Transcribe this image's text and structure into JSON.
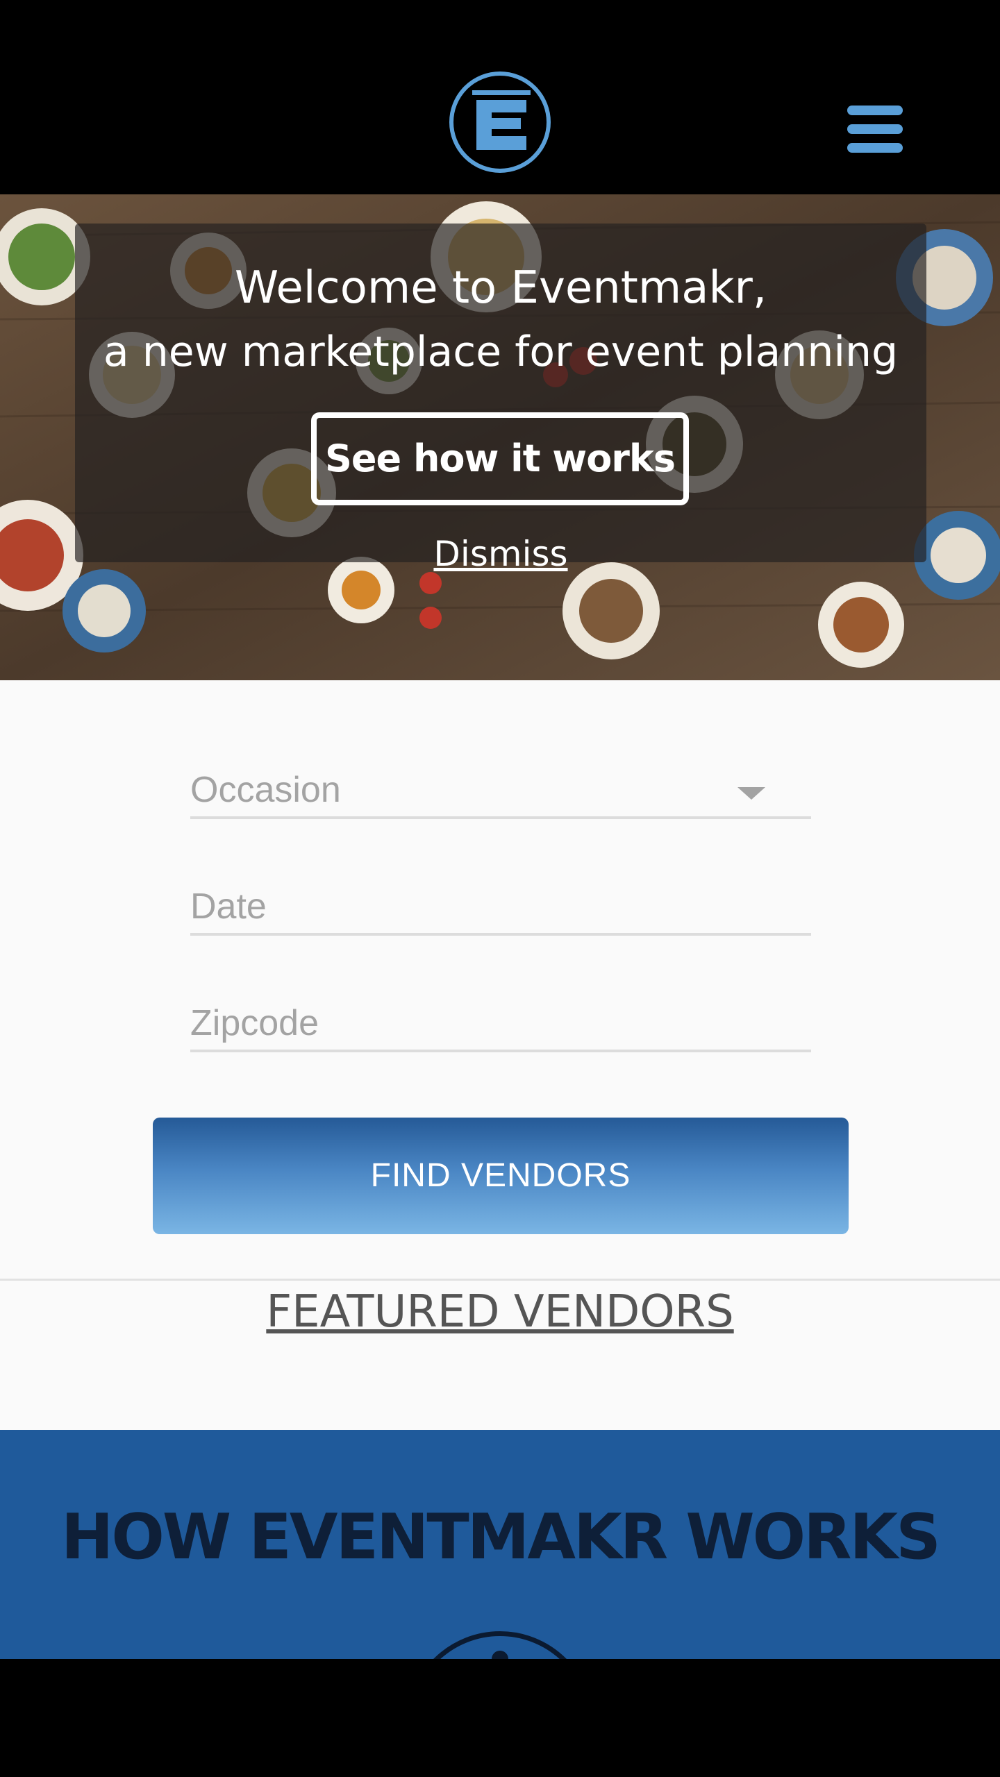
{
  "header": {
    "logo_letter": "E",
    "logo_icon": "eventmakr-logo-icon",
    "menu_icon": "hamburger-menu-icon"
  },
  "hero": {
    "line1": "Welcome to Eventmakr,",
    "line2": "a new marketplace for event planning",
    "cta_label": "See how it works",
    "dismiss_label": "Dismiss"
  },
  "search": {
    "occasion_placeholder": "Occasion",
    "date_placeholder": "Date",
    "zipcode_placeholder": "Zipcode",
    "find_button": "FIND VENDORS"
  },
  "featured": {
    "title": "FEATURED VENDORS"
  },
  "how": {
    "title": "HOW EVENTMAKR WORKS"
  },
  "colors": {
    "brand_blue": "#1f5a9b",
    "logo_blue": "#5a9fd8",
    "button_top": "#255a97",
    "button_bottom": "#7ab5e4"
  }
}
